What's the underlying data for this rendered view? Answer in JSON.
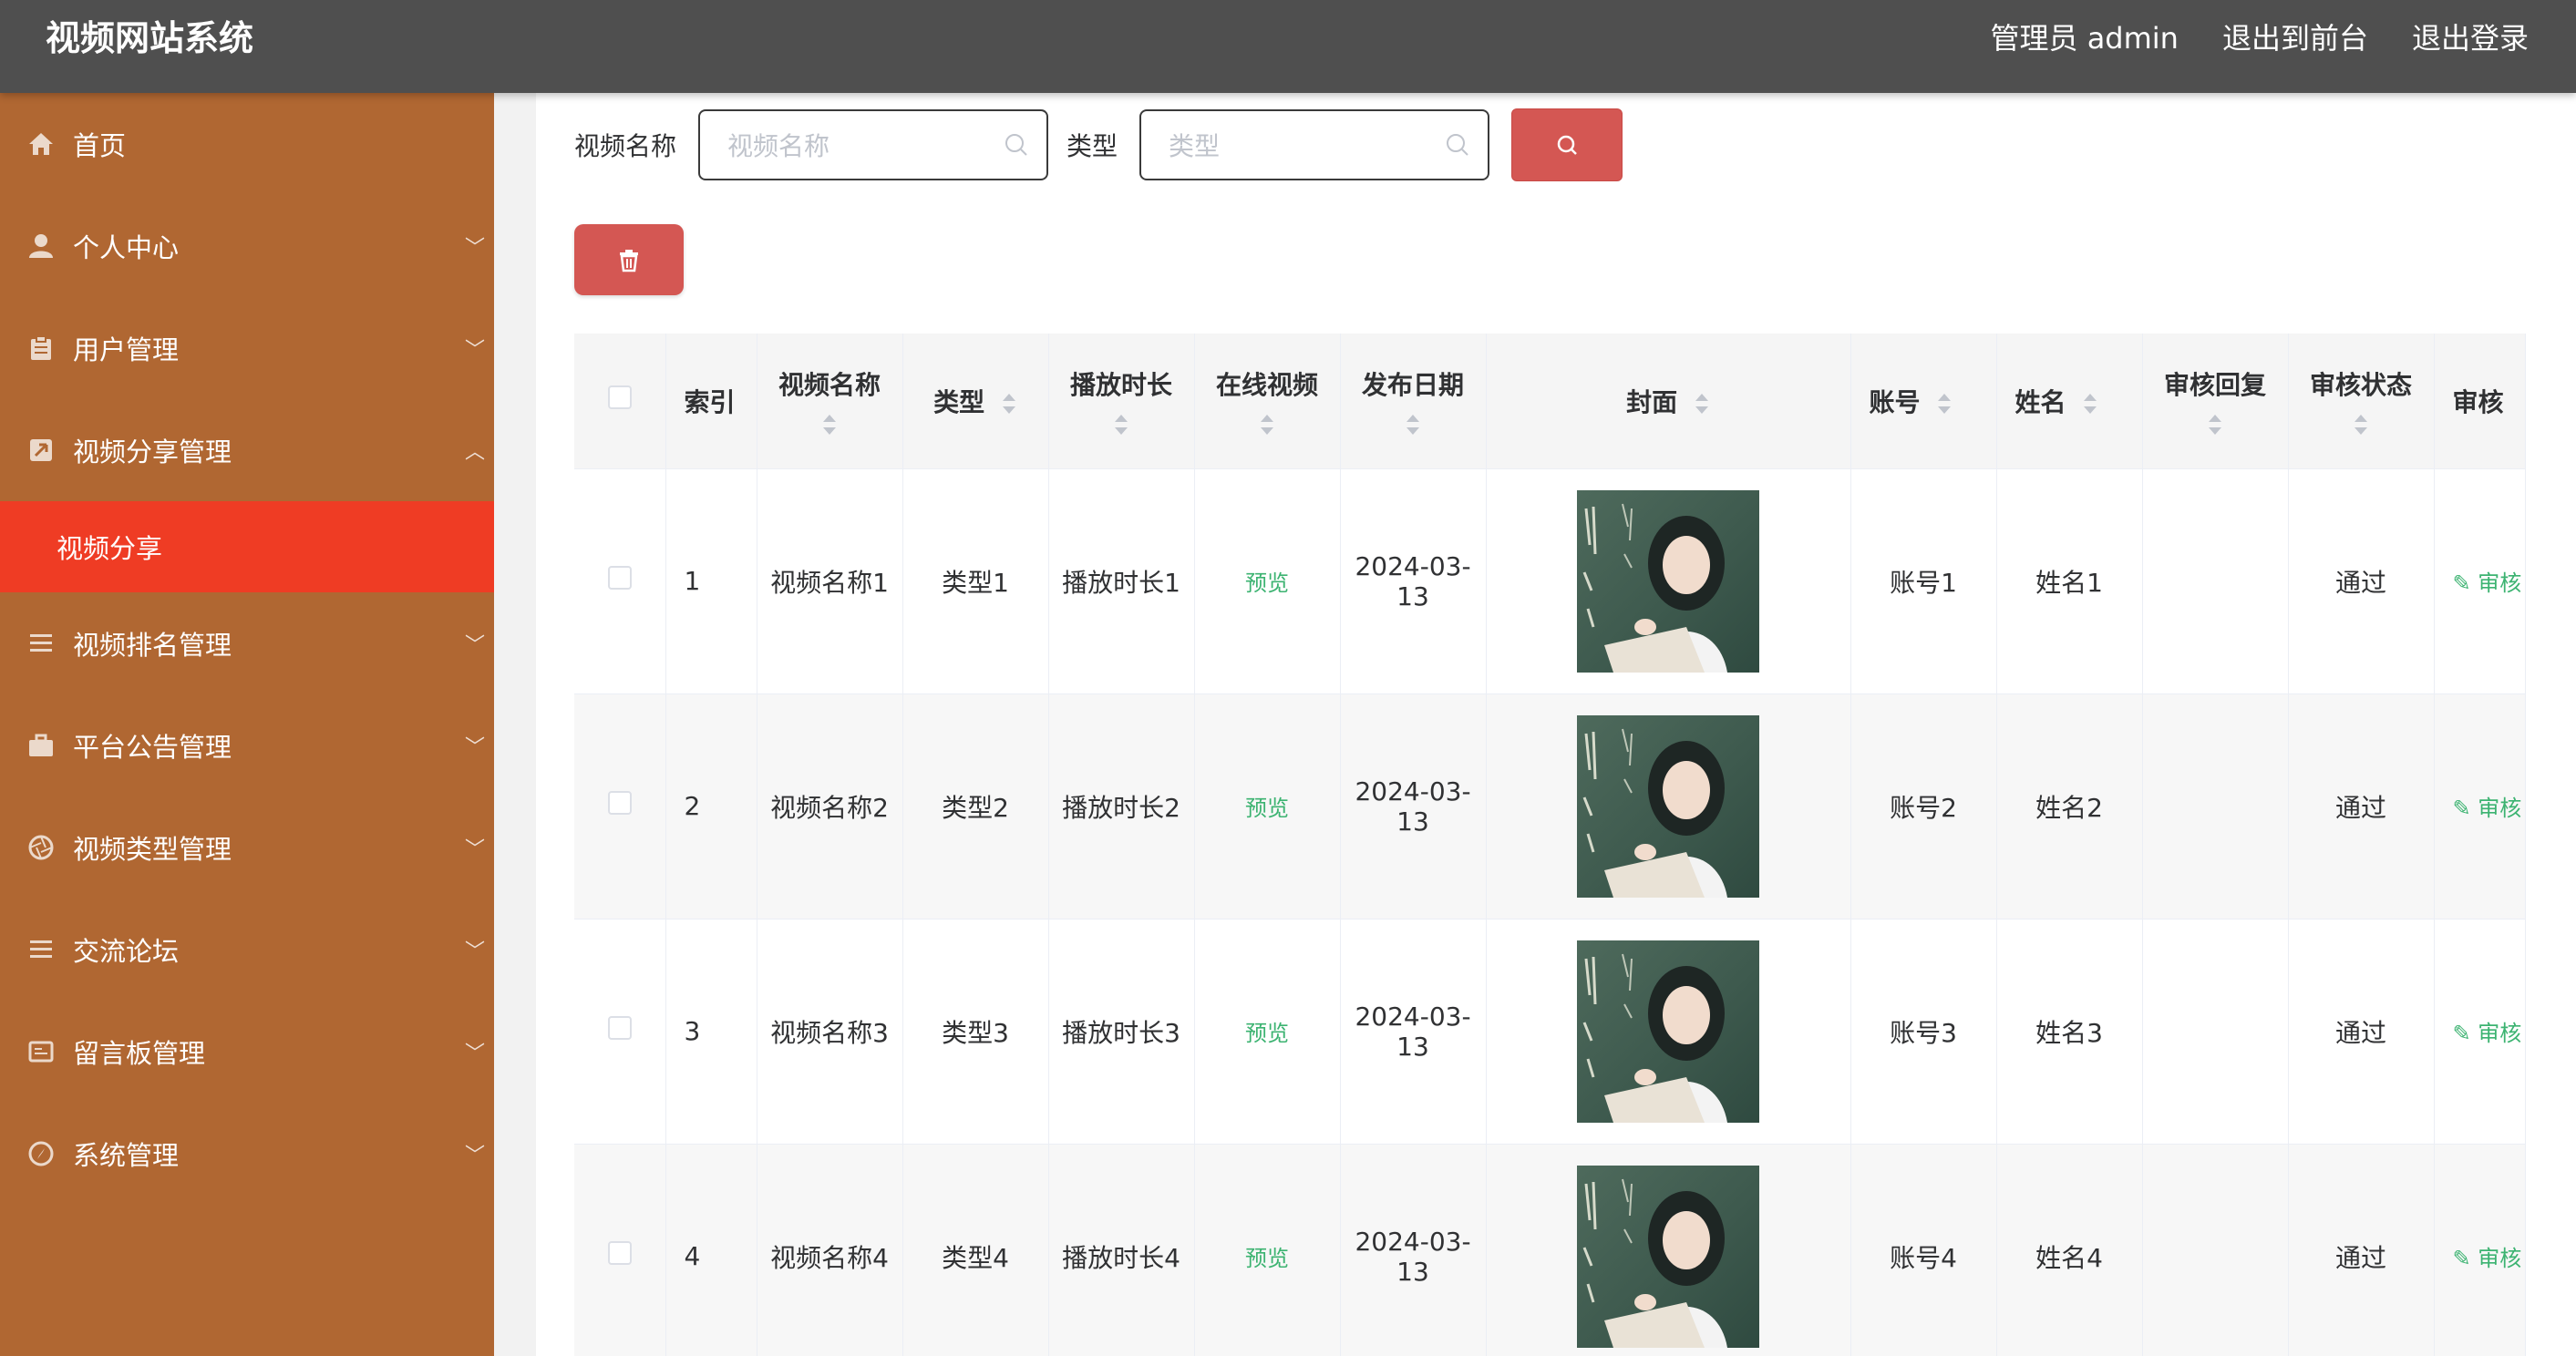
{
  "header": {
    "title": "视频网站系统",
    "admin_label": "管理员 admin",
    "exit_front": "退出到前台",
    "logout": "退出登录"
  },
  "sidebar": {
    "items": [
      {
        "label": "首页",
        "icon": "home-icon"
      },
      {
        "label": "个人中心",
        "icon": "user-icon"
      },
      {
        "label": "用户管理",
        "icon": "clipboard-icon"
      },
      {
        "label": "视频分享管理",
        "icon": "share-icon",
        "expanded": true
      },
      {
        "label": "视频排名管理",
        "icon": "list-icon"
      },
      {
        "label": "平台公告管理",
        "icon": "briefcase-icon"
      },
      {
        "label": "视频类型管理",
        "icon": "aperture-icon"
      },
      {
        "label": "交流论坛",
        "icon": "menu-icon"
      },
      {
        "label": "留言板管理",
        "icon": "message-board-icon"
      },
      {
        "label": "系统管理",
        "icon": "compass-icon"
      }
    ],
    "active_sub": "视频分享",
    "active_color": "#ef3c24",
    "bg_color": "#b06732"
  },
  "filters": {
    "name_label": "视频名称",
    "name_placeholder": "视频名称",
    "type_label": "类型",
    "type_placeholder": "类型"
  },
  "table": {
    "headers": {
      "index": "索引",
      "name": "视频名称",
      "type": "类型",
      "duration": "播放时长",
      "online": "在线视频",
      "date": "发布日期",
      "cover": "封面",
      "account": "账号",
      "person": "姓名",
      "reply": "审核回复",
      "status": "审核状态",
      "audit": "审核"
    },
    "rows": [
      {
        "index": "1",
        "name": "视频名称1",
        "type": "类型1",
        "duration": "播放时长1",
        "online": "预览",
        "date": "2024-03-13",
        "account": "账号1",
        "person": "姓名1",
        "reply": "",
        "status": "通过",
        "audit": "审核"
      },
      {
        "index": "2",
        "name": "视频名称2",
        "type": "类型2",
        "duration": "播放时长2",
        "online": "预览",
        "date": "2024-03-13",
        "account": "账号2",
        "person": "姓名2",
        "reply": "",
        "status": "通过",
        "audit": "审核"
      },
      {
        "index": "3",
        "name": "视频名称3",
        "type": "类型3",
        "duration": "播放时长3",
        "online": "预览",
        "date": "2024-03-13",
        "account": "账号3",
        "person": "姓名3",
        "reply": "",
        "status": "通过",
        "audit": "审核"
      },
      {
        "index": "4",
        "name": "视频名称4",
        "type": "类型4",
        "duration": "播放时长4",
        "online": "预览",
        "date": "2024-03-13",
        "account": "账号4",
        "person": "姓名4",
        "reply": "",
        "status": "通过",
        "audit": "审核"
      }
    ]
  },
  "colors": {
    "topbar": "#4f4f4f",
    "accent_red": "#d45753",
    "link_green": "#3cb371"
  }
}
